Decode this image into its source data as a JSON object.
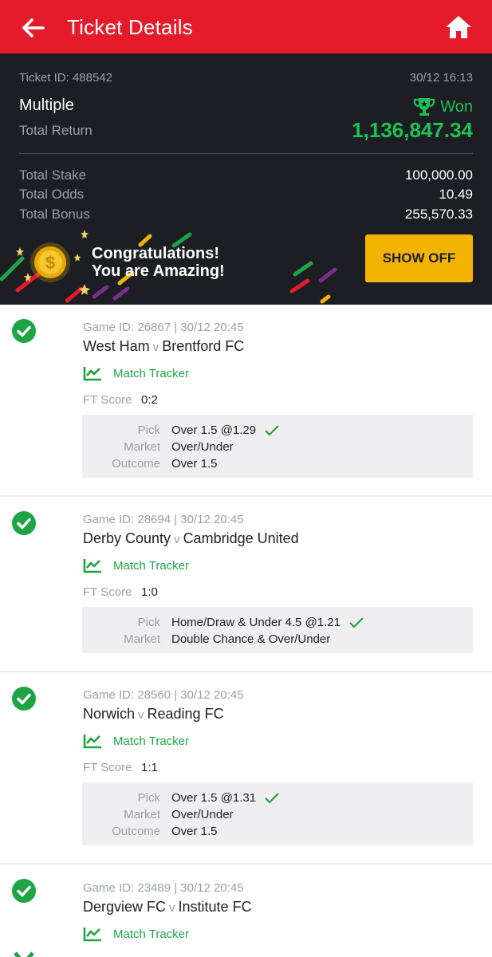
{
  "header": {
    "title": "Ticket Details"
  },
  "ticket": {
    "id_label": "Ticket ID: 488542",
    "datetime": "30/12 16:13",
    "type": "Multiple",
    "status": "Won",
    "total_return_label": "Total Return",
    "total_return": "1,136,847.34",
    "rows": [
      {
        "label": "Total Stake",
        "value": "100,000.00"
      },
      {
        "label": "Total Odds",
        "value": "10.49"
      },
      {
        "label": "Total Bonus",
        "value": "255,570.33"
      }
    ],
    "banner_line1": "Congratulations!",
    "banner_line2": "You are Amazing!",
    "show_off_label": "SHOW OFF"
  },
  "labels": {
    "match_tracker": "Match Tracker",
    "ft_score": "FT Score",
    "vs": "v",
    "pick": "Pick",
    "market": "Market",
    "outcome": "Outcome"
  },
  "selections": [
    {
      "game": "Game ID: 26867 | 30/12 20:45",
      "home": "West Ham",
      "away": "Brentford FC",
      "ft": "0:2",
      "pick": "Over 1.5 @1.29",
      "market": "Over/Under",
      "outcome": "Over 1.5"
    },
    {
      "game": "Game ID: 28694 | 30/12 20:45",
      "home": "Derby County",
      "away": "Cambridge United",
      "ft": "1:0",
      "pick": "Home/Draw & Under 4.5 @1.21",
      "market": "Double Chance & Over/Under"
    },
    {
      "game": "Game ID: 28560 | 30/12 20:45",
      "home": "Norwich",
      "away": "Reading FC",
      "ft": "1:1",
      "pick": "Over 1.5 @1.31",
      "market": "Over/Under",
      "outcome": "Over 1.5"
    },
    {
      "game": "Game ID: 23489 | 30/12 20:45",
      "home": "Dergview FC",
      "away": "Institute FC"
    }
  ],
  "colors": {
    "brand_red": "#e41b2b",
    "panel_dark": "#1c1e24",
    "win_green": "#1fbf56",
    "check_green": "#1ea446",
    "button_yellow": "#f2b400"
  }
}
